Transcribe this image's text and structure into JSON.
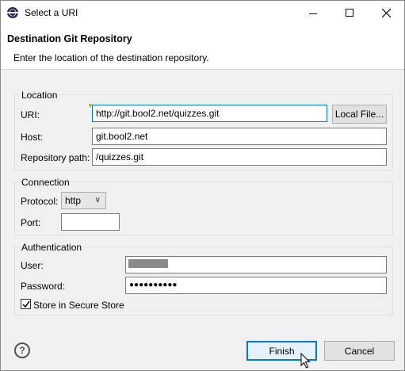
{
  "window": {
    "title": "Select a URI",
    "icon": "eclipse-icon"
  },
  "header": {
    "title": "Destination Git Repository",
    "description": "Enter the location of the destination repository."
  },
  "location": {
    "group_label": "Location",
    "uri_label": "URI:",
    "uri_value": "http://git.bool2.net/quizzes.git",
    "local_file_button": "Local File...",
    "host_label": "Host:",
    "host_value": "git.bool2.net",
    "repo_path_label": "Repository path:",
    "repo_path_value": "/quizzes.git"
  },
  "connection": {
    "group_label": "Connection",
    "protocol_label": "Protocol:",
    "protocol_value": "http",
    "port_label": "Port:",
    "port_value": ""
  },
  "authentication": {
    "group_label": "Authentication",
    "user_label": "User:",
    "user_value": "",
    "password_label": "Password:",
    "password_value": "●●●●●●●●●●",
    "store_label": "Store in Secure Store",
    "store_checked": true
  },
  "footer": {
    "finish_button": "Finish",
    "cancel_button": "Cancel"
  }
}
